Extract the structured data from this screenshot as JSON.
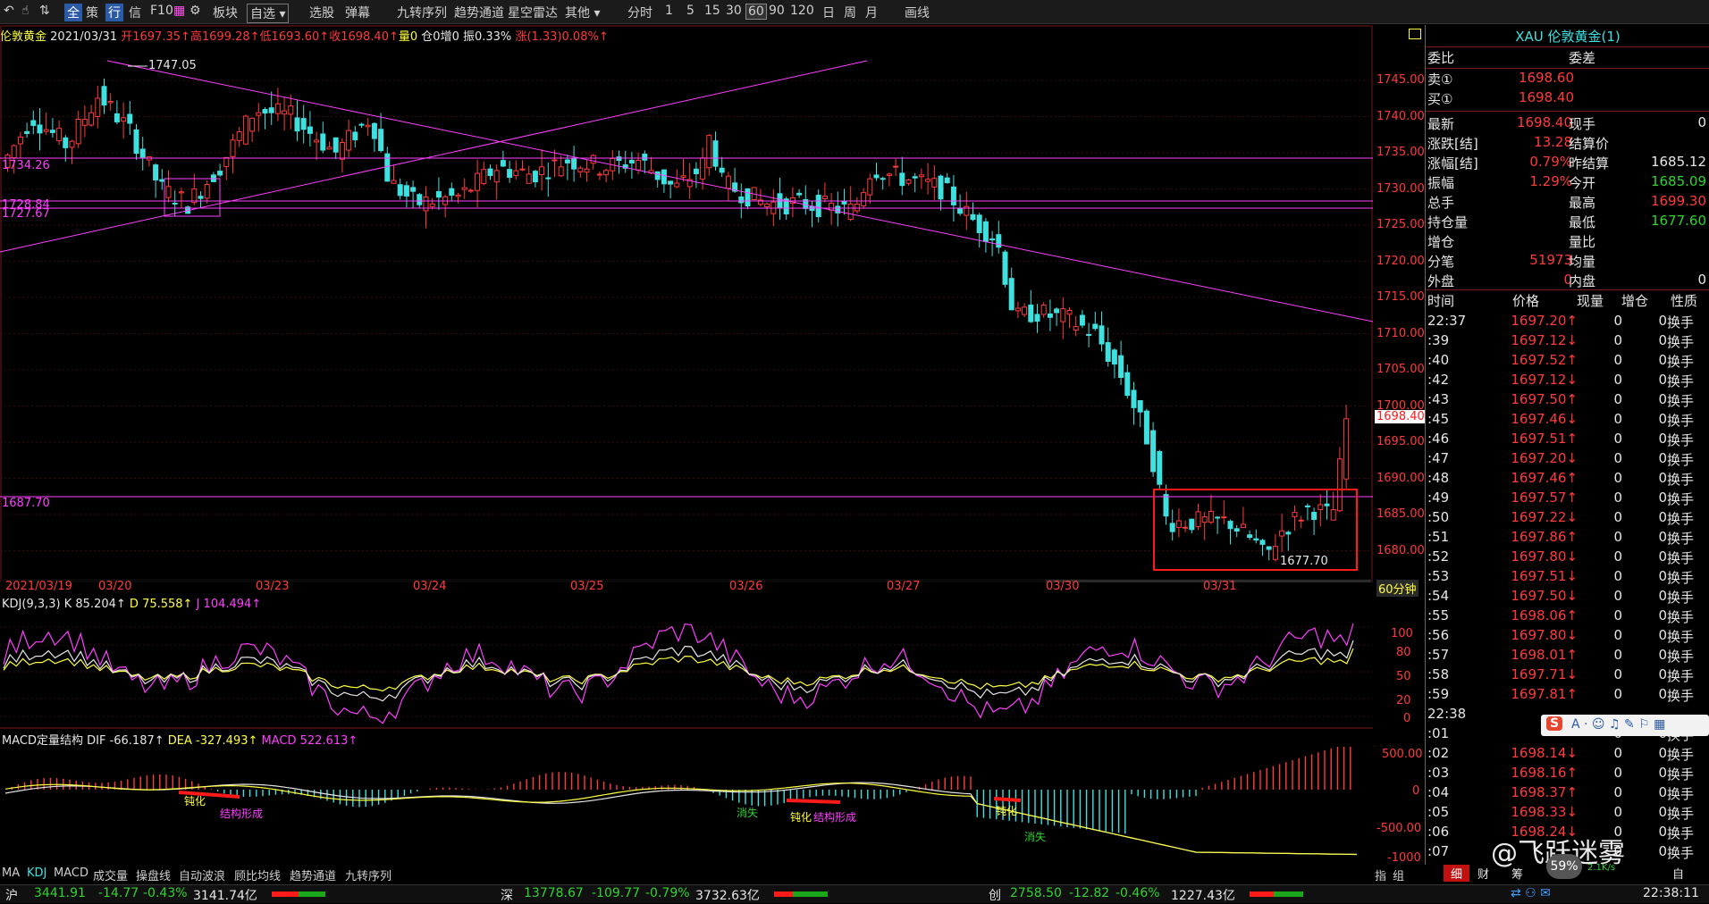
{
  "toolbar": {
    "items": [
      "全",
      "策",
      "行",
      "信",
      "F10",
      "板块",
      "自选",
      "选股",
      "弹幕",
      "九转序列",
      "趋势通道",
      "星空雷达",
      "其他",
      "分时",
      "1",
      "5",
      "15",
      "30",
      "60",
      "90",
      "120",
      "日",
      "周",
      "月",
      "画线"
    ]
  },
  "info_bar": {
    "name": "伦敦黄金",
    "date": "2021/03/31",
    "open": "开1697.35↑",
    "high": "高1699.28↑",
    "low": "低1693.60↑",
    "close": "收1698.40↑",
    "volume": "量0",
    "position": "仓0",
    "increase": "增0",
    "amplitude": "振0.33%",
    "change": "涨(1.33)0.08%↑"
  },
  "price_axis": [
    "1745.00",
    "1740.00",
    "1735.00",
    "1730.00",
    "1725.00",
    "1720.00",
    "1715.00",
    "1710.00",
    "1705.00",
    "1700.00",
    "1695.00",
    "1690.00",
    "1685.00",
    "1680.00"
  ],
  "current_price_tag": "1698.40",
  "annotations": {
    "high_marker": "1747.05",
    "low_marker": "1677.70",
    "line_1734": "1734.26",
    "line_1728a": "1728.84",
    "line_1728b": "1727.67",
    "line_1687": "1687.70"
  },
  "date_axis": [
    "2021/03/19",
    "03/20",
    "03/23",
    "03/24",
    "03/25",
    "03/26",
    "03/27",
    "03/30",
    "03/31"
  ],
  "period_label": "60分钟",
  "kdj": {
    "title": "KDJ(9,3,3)",
    "k": "K 85.204↑",
    "d": "D 75.558↑",
    "j": "J 104.494↑",
    "axis": [
      "100",
      "80",
      "50",
      "20",
      "0"
    ]
  },
  "macd": {
    "title": "MACD定量结构",
    "dif": "DIF -66.187↑",
    "dea": "DEA -327.493↑",
    "macd": "MACD 522.613↑",
    "axis": [
      "500.00",
      "0",
      "-500.00",
      "-1000"
    ],
    "labels": [
      "钝化",
      "结构形成",
      "消失",
      "钝化",
      "结构形成",
      "钝化",
      "消失"
    ]
  },
  "bottom_tabs": [
    "MA",
    "KDJ",
    "MACD",
    "成交量",
    "操盘线",
    "自动波浪",
    "顾比均线",
    "趋势通道",
    "九转序列"
  ],
  "bottom_right_tabs": [
    "指",
    "组"
  ],
  "right_panel": {
    "title": "XAU 伦敦黄金(1)",
    "wb_label": "委比",
    "wc_label": "委差",
    "sell_label": "卖①",
    "sell_price": "1698.60",
    "buy_label": "买①",
    "buy_price": "1698.40",
    "stats": [
      {
        "l1": "最新",
        "v1": "1698.40",
        "l2": "现手",
        "v2": "0"
      },
      {
        "l1": "涨跌[结]",
        "v1": "13.28",
        "l2": "结算价",
        "v2": ""
      },
      {
        "l1": "涨幅[结]",
        "v1": "0.79%",
        "l2": "昨结算",
        "v2": "1685.12"
      },
      {
        "l1": "振幅",
        "v1": "1.29%",
        "l2": "今开",
        "v2": "1685.09"
      },
      {
        "l1": "总手",
        "v1": "",
        "l2": "最高",
        "v2": "1699.30"
      },
      {
        "l1": "持仓量",
        "v1": "",
        "l2": "最低",
        "v2": "1677.60"
      },
      {
        "l1": "增仓",
        "v1": "",
        "l2": "量比",
        "v2": ""
      },
      {
        "l1": "分笔",
        "v1": "51973",
        "l2": "均量",
        "v2": ""
      },
      {
        "l1": "外盘",
        "v1": "0",
        "l2": "内盘",
        "v2": "0"
      }
    ],
    "trade_headers": [
      "时间",
      "价格",
      "现量",
      "增仓",
      "性质"
    ],
    "trades": [
      {
        "t": "22:37",
        "p": "1697.20↑",
        "v": "0",
        "z": "0",
        "n": "换手"
      },
      {
        "t": ":39",
        "p": "1697.12↓",
        "v": "0",
        "z": "0",
        "n": "换手"
      },
      {
        "t": ":40",
        "p": "1697.52↑",
        "v": "0",
        "z": "0",
        "n": "换手"
      },
      {
        "t": ":42",
        "p": "1697.12↓",
        "v": "0",
        "z": "0",
        "n": "换手"
      },
      {
        "t": ":43",
        "p": "1697.50↑",
        "v": "0",
        "z": "0",
        "n": "换手"
      },
      {
        "t": ":45",
        "p": "1697.46↓",
        "v": "0",
        "z": "0",
        "n": "换手"
      },
      {
        "t": ":46",
        "p": "1697.51↑",
        "v": "0",
        "z": "0",
        "n": "换手"
      },
      {
        "t": ":47",
        "p": "1697.20↓",
        "v": "0",
        "z": "0",
        "n": "换手"
      },
      {
        "t": ":48",
        "p": "1697.46↑",
        "v": "0",
        "z": "0",
        "n": "换手"
      },
      {
        "t": ":49",
        "p": "1697.57↑",
        "v": "0",
        "z": "0",
        "n": "换手"
      },
      {
        "t": ":50",
        "p": "1697.22↓",
        "v": "0",
        "z": "0",
        "n": "换手"
      },
      {
        "t": ":51",
        "p": "1697.86↑",
        "v": "0",
        "z": "0",
        "n": "换手"
      },
      {
        "t": ":52",
        "p": "1697.80↓",
        "v": "0",
        "z": "0",
        "n": "换手"
      },
      {
        "t": ":53",
        "p": "1697.51↓",
        "v": "0",
        "z": "0",
        "n": "换手"
      },
      {
        "t": ":54",
        "p": "1697.50↓",
        "v": "0",
        "z": "0",
        "n": "换手"
      },
      {
        "t": ":55",
        "p": "1698.06↑",
        "v": "0",
        "z": "0",
        "n": "换手"
      },
      {
        "t": ":56",
        "p": "1697.80↓",
        "v": "0",
        "z": "0",
        "n": "换手"
      },
      {
        "t": ":57",
        "p": "1698.01↑",
        "v": "0",
        "z": "0",
        "n": "换手"
      },
      {
        "t": ":58",
        "p": "1697.71↓",
        "v": "0",
        "z": "0",
        "n": "换手"
      },
      {
        "t": ":59",
        "p": "1697.81↑",
        "v": "0",
        "z": "0",
        "n": "换手"
      },
      {
        "t": "22:38",
        "p": "",
        "v": "",
        "z": "",
        "n": ""
      },
      {
        "t": ":01",
        "p": "",
        "v": "0",
        "z": "0",
        "n": "换手"
      },
      {
        "t": ":02",
        "p": "1698.14↓",
        "v": "0",
        "z": "0",
        "n": "换手"
      },
      {
        "t": ":03",
        "p": "1698.16↑",
        "v": "0",
        "z": "0",
        "n": "换手"
      },
      {
        "t": ":04",
        "p": "1698.37↑",
        "v": "0",
        "z": "0",
        "n": "换手"
      },
      {
        "t": ":05",
        "p": "1698.33↓",
        "v": "0",
        "z": "0",
        "n": "换手"
      },
      {
        "t": ":06",
        "p": "1698.24↓",
        "v": "0",
        "z": "0",
        "n": "换手"
      },
      {
        "t": ":07",
        "p": "",
        "v": "0",
        "z": "0",
        "n": "换手"
      }
    ],
    "panel_tabs": [
      "细",
      "财",
      "筹",
      "自"
    ]
  },
  "watermark": "@飞跃迷雾",
  "cpu_badge": "59%",
  "net_speed": "2.1K/s",
  "status_bar": {
    "sh_label": "沪",
    "sh_index": "3441.91",
    "sh_change": "-14.77",
    "sh_pct": "-0.43%",
    "sh_amount": "3141.74亿",
    "sz_label": "深",
    "sz_index": "13778.67",
    "sz_change": "-109.77",
    "sz_pct": "-0.79%",
    "sz_amount": "3732.63亿",
    "cy_label": "创",
    "cy_index": "2758.50",
    "cy_change": "-12.82",
    "cy_pct": "-0.46%",
    "cy_amount": "1227.43亿",
    "clock": "22:38:11"
  },
  "colors": {
    "up": "#ff3b3b",
    "down": "#3fe0e0",
    "line": "#ff40ff",
    "bg": "#000000"
  }
}
